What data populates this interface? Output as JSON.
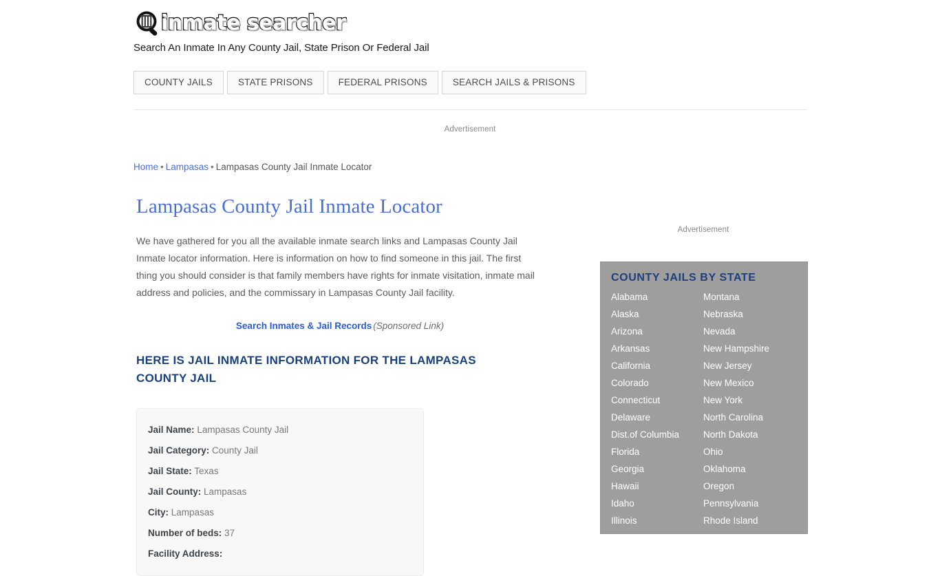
{
  "site": {
    "logo_word": "inmate searcher",
    "logo_icon": "magnifier-jail-icon",
    "tagline": "Search An Inmate In Any County Jail, State Prison Or Federal Jail"
  },
  "nav": {
    "items": [
      {
        "label": "COUNTY JAILS"
      },
      {
        "label": "STATE PRISONS"
      },
      {
        "label": "FEDERAL PRISONS"
      },
      {
        "label": "SEARCH JAILS & PRISONS"
      }
    ]
  },
  "ads": {
    "top_label": "Advertisement",
    "side_label": "Advertisement"
  },
  "breadcrumb": {
    "items": [
      {
        "label": "Home",
        "link": true
      },
      {
        "label": "Lampasas",
        "link": true
      },
      {
        "label": "Lampasas County Jail Inmate Locator",
        "link": false
      }
    ],
    "separator": "•"
  },
  "main": {
    "title": "Lampasas County Jail Inmate Locator",
    "intro": "We have gathered for you all the available inmate search links and Lampasas County Jail Inmate locator information. Here is information on how to find someone in this jail. The first thing you should consider is that family members have rights for inmate visitation, inmate mail address and policies, and the commissary in Lampasas County Jail facility.",
    "sponsored_link": "Search Inmates & Jail Records",
    "sponsored_note": "(Sponsored Link)",
    "section_title": "HERE IS JAIL INMATE INFORMATION FOR THE LAMPASAS COUNTY JAIL",
    "info_rows": [
      {
        "label": "Jail Name:",
        "value": "Lampasas County Jail"
      },
      {
        "label": "Jail Category:",
        "value": "County Jail"
      },
      {
        "label": "Jail State:",
        "value": "Texas"
      },
      {
        "label": "Jail County:",
        "value": "Lampasas"
      },
      {
        "label": "City:",
        "value": "Lampasas"
      },
      {
        "label": "Number of beds:",
        "value": "37"
      },
      {
        "label": "Facility Address:",
        "value": ""
      }
    ]
  },
  "sidebar": {
    "states_title": "COUNTY JAILS BY STATE",
    "states_left": [
      "Alabama",
      "Alaska",
      "Arizona",
      "Arkansas",
      "California",
      "Colorado",
      "Connecticut",
      "Delaware",
      "Dist.of Columbia",
      "Florida",
      "Georgia",
      "Hawaii",
      "Idaho",
      "Illinois"
    ],
    "states_right": [
      "Montana",
      "Nebraska",
      "Nevada",
      "New Hampshire",
      "New Jersey",
      "New Mexico",
      "New York",
      "North Carolina",
      "North Dakota",
      "Ohio",
      "Oklahoma",
      "Oregon",
      "Pennsylvania",
      "Rhode Island"
    ]
  },
  "colors": {
    "link_blue": "#4a6fd4",
    "title_blue": "#4a6fd4",
    "heading_navy": "#17417e",
    "sidebar_bg": "#9e9e9e",
    "sidebar_title": "#1d3f7d",
    "body_text": "#5a5a5a"
  }
}
